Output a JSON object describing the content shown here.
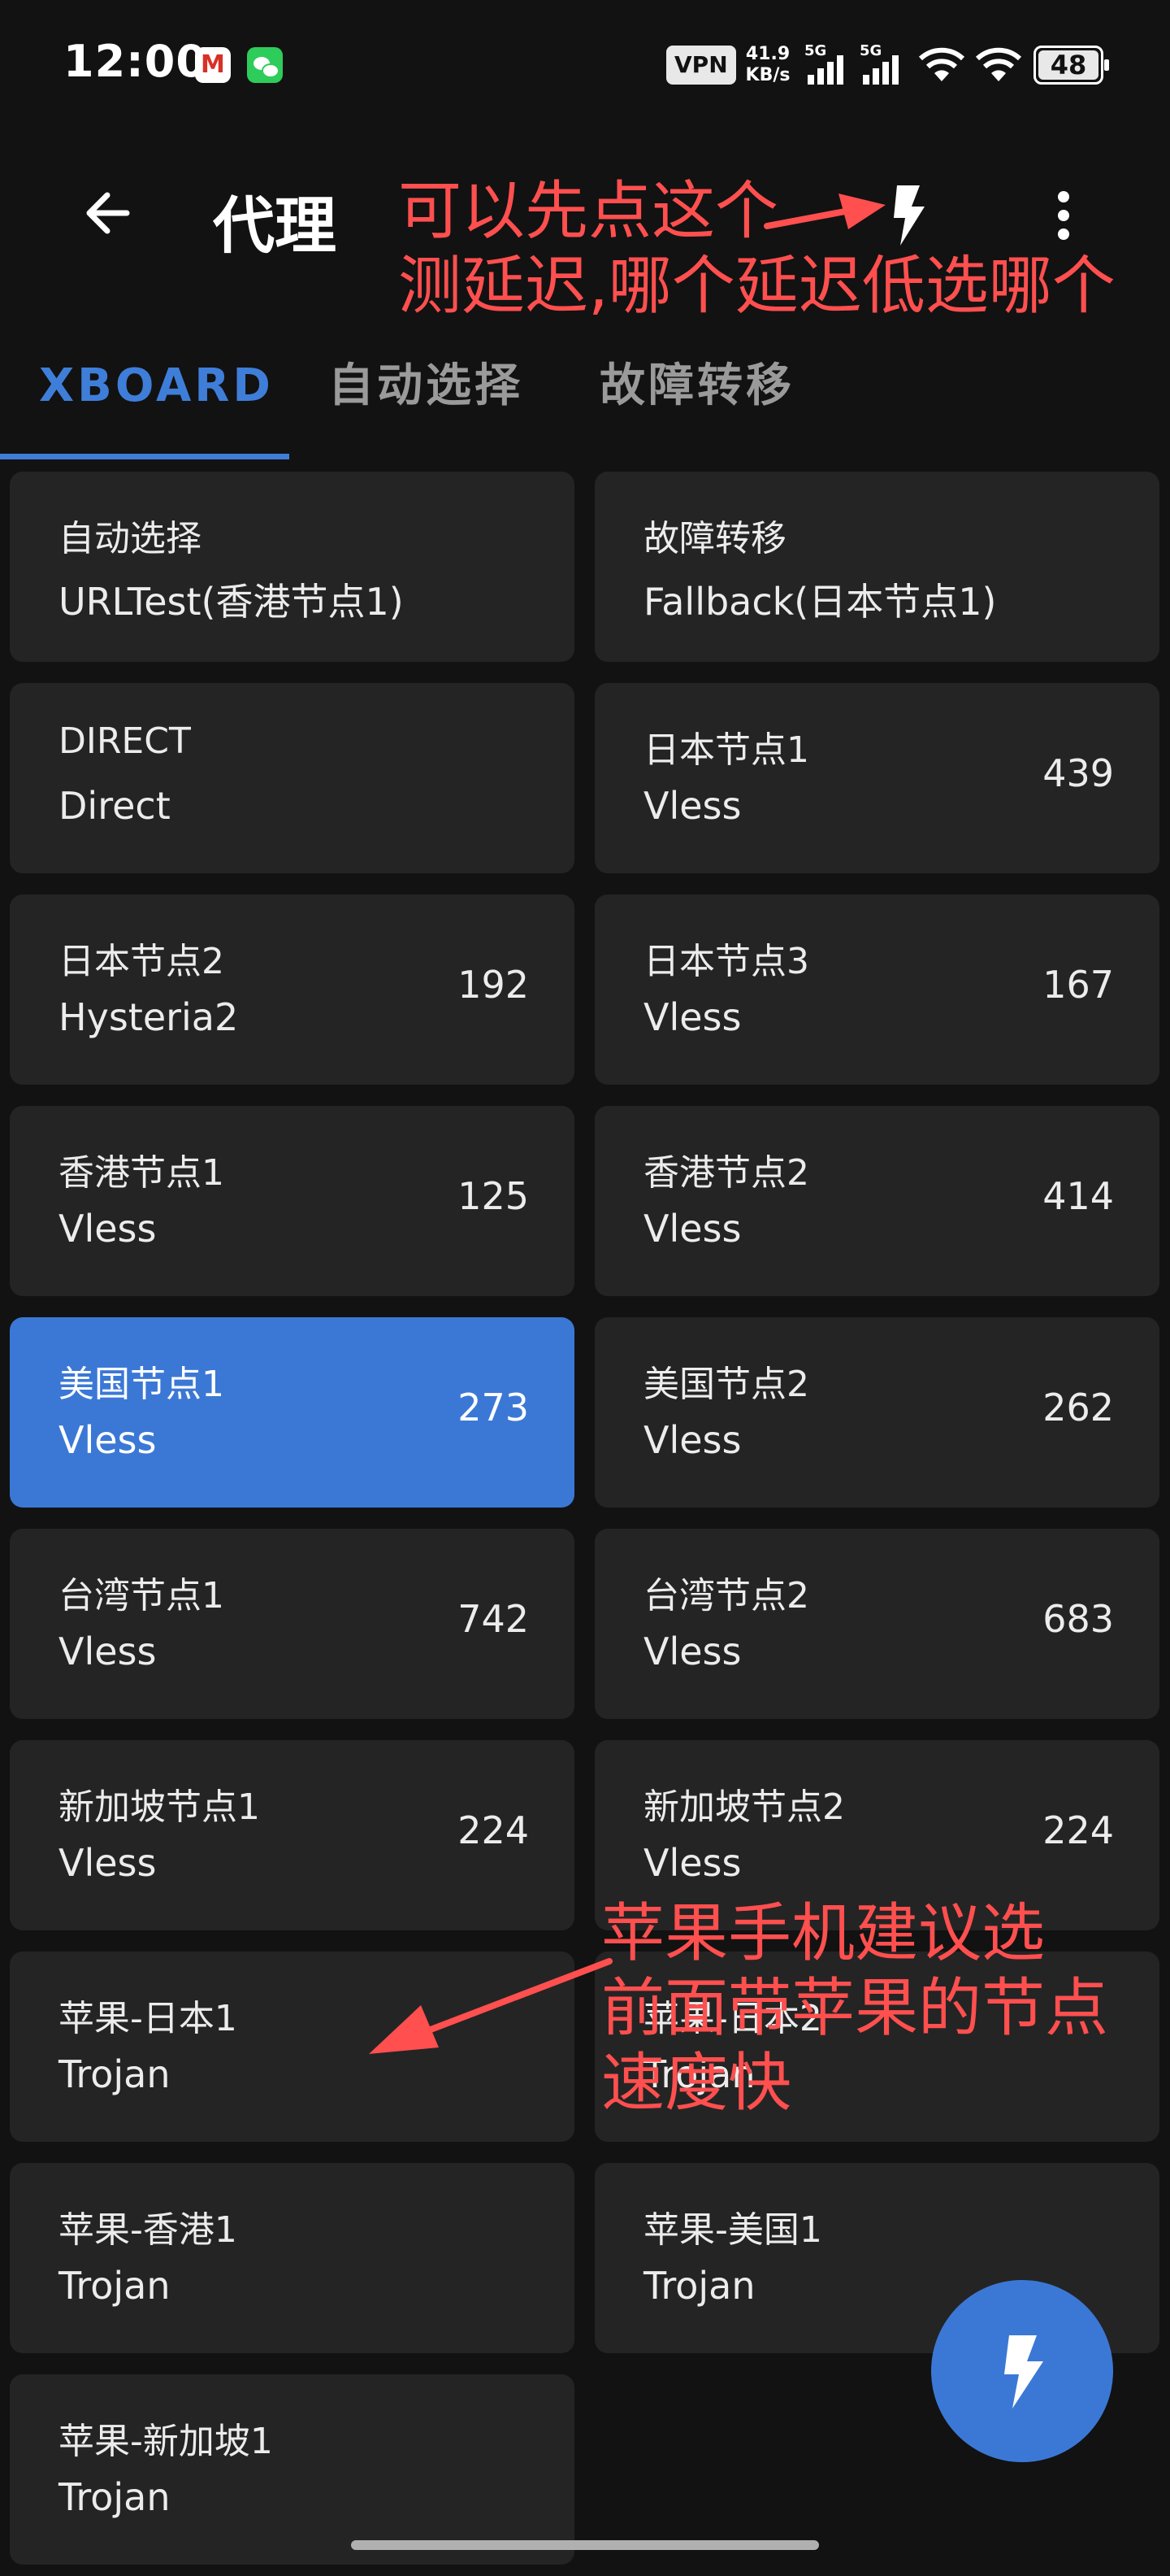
{
  "status_bar": {
    "time": "12:00",
    "vpn": "VPN",
    "speed_value": "41.9",
    "speed_unit": "KB/s",
    "signal1_label": "5G",
    "signal2_label": "5G",
    "battery": "48"
  },
  "app_bar": {
    "title": "代理"
  },
  "annotations": {
    "top_line1": "可以先点这个",
    "top_line2": "测延迟,哪个延迟低选哪个",
    "mid_line1": "苹果手机建议选",
    "mid_line2": "前面带苹果的节点",
    "mid_line3": "速度快"
  },
  "tabs": [
    {
      "label": "XBOARD"
    },
    {
      "label": "自动选择"
    },
    {
      "label": "故障转移"
    }
  ],
  "proxies": [
    {
      "name": "自动选择",
      "type": "URLTest(香港节点1)",
      "delay": ""
    },
    {
      "name": "故障转移",
      "type": "Fallback(日本节点1)",
      "delay": ""
    },
    {
      "name": "DIRECT",
      "type": "Direct",
      "delay": ""
    },
    {
      "name": "日本节点1",
      "type": "Vless",
      "delay": "439"
    },
    {
      "name": "日本节点2",
      "type": "Hysteria2",
      "delay": "192"
    },
    {
      "name": "日本节点3",
      "type": "Vless",
      "delay": "167"
    },
    {
      "name": "香港节点1",
      "type": "Vless",
      "delay": "125"
    },
    {
      "name": "香港节点2",
      "type": "Vless",
      "delay": "414"
    },
    {
      "name": "美国节点1",
      "type": "Vless",
      "delay": "273",
      "selected": true
    },
    {
      "name": "美国节点2",
      "type": "Vless",
      "delay": "262"
    },
    {
      "name": "台湾节点1",
      "type": "Vless",
      "delay": "742"
    },
    {
      "name": "台湾节点2",
      "type": "Vless",
      "delay": "683"
    },
    {
      "name": "新加坡节点1",
      "type": "Vless",
      "delay": "224"
    },
    {
      "name": "新加坡节点2",
      "type": "Vless",
      "delay": "224"
    },
    {
      "name": "苹果-日本1",
      "type": "Trojan",
      "delay": ""
    },
    {
      "name": "苹果-日本2",
      "type": "Trojan",
      "delay": ""
    },
    {
      "name": "苹果-香港1",
      "type": "Trojan",
      "delay": ""
    },
    {
      "name": "苹果-美国1",
      "type": "Trojan",
      "delay": ""
    },
    {
      "name": "苹果-新加坡1",
      "type": "Trojan",
      "delay": ""
    }
  ],
  "colors": {
    "accent": "#3b78d6",
    "background": "#121212",
    "card": "#242424",
    "annotation": "#ff4f4f"
  }
}
